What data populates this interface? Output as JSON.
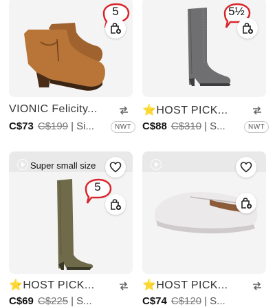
{
  "listings": [
    {
      "title": "VIONIC Felicity...",
      "host_pick": false,
      "price": "C$73",
      "original_price": "C$199",
      "size_short": "Si...",
      "condition": "NWT",
      "size_bubble": "5",
      "has_like": false,
      "has_video": false,
      "promo": ""
    },
    {
      "title": "HOST PICK...",
      "host_pick": true,
      "price": "C$88",
      "original_price": "C$310",
      "size_short": "S...",
      "condition": "NWT",
      "size_bubble": "5½",
      "has_like": false,
      "has_video": false,
      "promo": ""
    },
    {
      "title": "HOST PICK...",
      "host_pick": true,
      "price": "C$69",
      "original_price": "C$225",
      "size_short": "S...",
      "condition": "NWT",
      "size_bubble": "5",
      "has_like": true,
      "has_video": true,
      "promo": "Super small size"
    },
    {
      "title": "HOST PICK...",
      "host_pick": true,
      "price": "C$74",
      "original_price": "C$120",
      "size_short": "S...",
      "condition": "NWT",
      "size_bubble": "",
      "has_like": true,
      "has_video": true,
      "promo": ""
    }
  ],
  "colors": {
    "bubble_red": "#d9262c",
    "star": "#f5b400",
    "image_bg": "#f4f4f4"
  },
  "icons": {
    "host_pick": "⭐",
    "repost": "repost-icon",
    "bag": "shopping-bag-add-icon",
    "like": "heart-icon",
    "video": "play-video-icon",
    "size_bubble": "speech-bubble-icon"
  }
}
